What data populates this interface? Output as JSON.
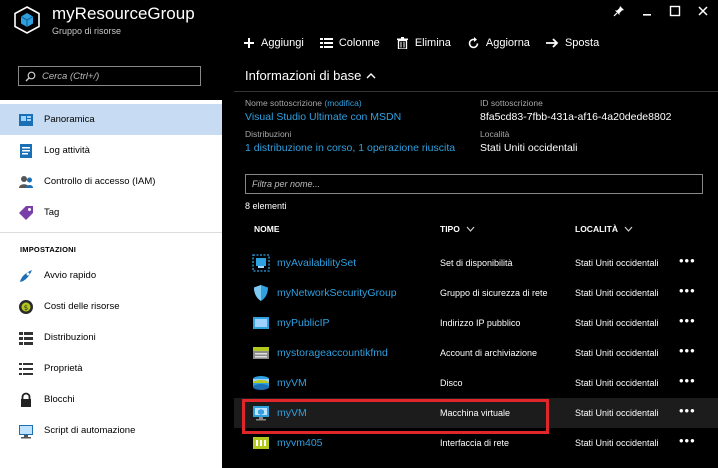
{
  "window": {
    "title": "myResourceGroup",
    "subtitle": "Gruppo di risorse"
  },
  "toolbar": {
    "items": [
      {
        "label": "Aggiungi",
        "icon": "plus-icon"
      },
      {
        "label": "Colonne",
        "icon": "columns-icon"
      },
      {
        "label": "Elimina",
        "icon": "trash-icon"
      },
      {
        "label": "Aggiorna",
        "icon": "refresh-icon"
      },
      {
        "label": "Sposta",
        "icon": "arrow-right-icon"
      }
    ]
  },
  "sidebar": {
    "search_placeholder": "Cerca (Ctrl+/)",
    "items": [
      {
        "label": "Panoramica",
        "icon": "overview-icon",
        "active": true
      },
      {
        "label": "Log attività",
        "icon": "activity-log-icon"
      },
      {
        "label": "Controllo di accesso (IAM)",
        "icon": "iam-icon"
      },
      {
        "label": "Tag",
        "icon": "tag-icon"
      }
    ],
    "section_label": "IMPOSTAZIONI",
    "settings_items": [
      {
        "label": "Avvio rapido",
        "icon": "quickstart-icon"
      },
      {
        "label": "Costi delle risorse",
        "icon": "costs-icon"
      },
      {
        "label": "Distribuzioni",
        "icon": "deployments-icon"
      },
      {
        "label": "Proprietà",
        "icon": "properties-icon"
      },
      {
        "label": "Blocchi",
        "icon": "lock-icon"
      },
      {
        "label": "Script di automazione",
        "icon": "script-icon"
      }
    ]
  },
  "main": {
    "section_title": "Informazioni di base",
    "subscription_label": "Nome sottoscrizione",
    "subscription_edit": "(modifica)",
    "subscription_value": "Visual Studio Ultimate con MSDN",
    "subscription_id_label": "ID sottoscrizione",
    "subscription_id_value": "8fa5cd83-7fbb-431a-af16-4a20dede8802",
    "deployments_label": "Distribuzioni",
    "deployments_value": "1 distribuzione in corso, 1 operazione riuscita",
    "location_label": "Località",
    "location_value": "Stati Uniti occidentali",
    "filter_placeholder": "Filtra per nome...",
    "count": "8 elementi",
    "columns": {
      "name": "NOME",
      "type": "TIPO",
      "location": "LOCALITÀ"
    },
    "more_label": "•••",
    "resources": [
      {
        "name": "myAvailabilitySet",
        "type": "Set di disponibilità",
        "location": "Stati Uniti occidentali",
        "icon": "availability-set-icon"
      },
      {
        "name": "myNetworkSecurityGroup",
        "type": "Gruppo di sicurezza di rete",
        "location": "Stati Uniti occidentali",
        "icon": "nsg-shield-icon"
      },
      {
        "name": "myPublicIP",
        "type": "Indirizzo IP pubblico",
        "location": "Stati Uniti occidentali",
        "icon": "public-ip-icon"
      },
      {
        "name": "mystorageaccountikfmd",
        "type": "Account di archiviazione",
        "location": "Stati Uniti occidentali",
        "icon": "storage-account-icon"
      },
      {
        "name": "myVM",
        "type": "Disco",
        "location": "Stati Uniti occidentali",
        "icon": "disk-icon"
      },
      {
        "name": "myVM",
        "type": "Macchina virtuale",
        "location": "Stati Uniti occidentali",
        "icon": "vm-icon",
        "selected": true
      },
      {
        "name": "myvm405",
        "type": "Interfaccia di rete",
        "location": "Stati Uniti occidentali",
        "icon": "nic-icon"
      }
    ]
  },
  "colors": {
    "link": "#2fa0e0",
    "highlight_box": "#e0262b",
    "active_nav": "#c7dcf2"
  }
}
